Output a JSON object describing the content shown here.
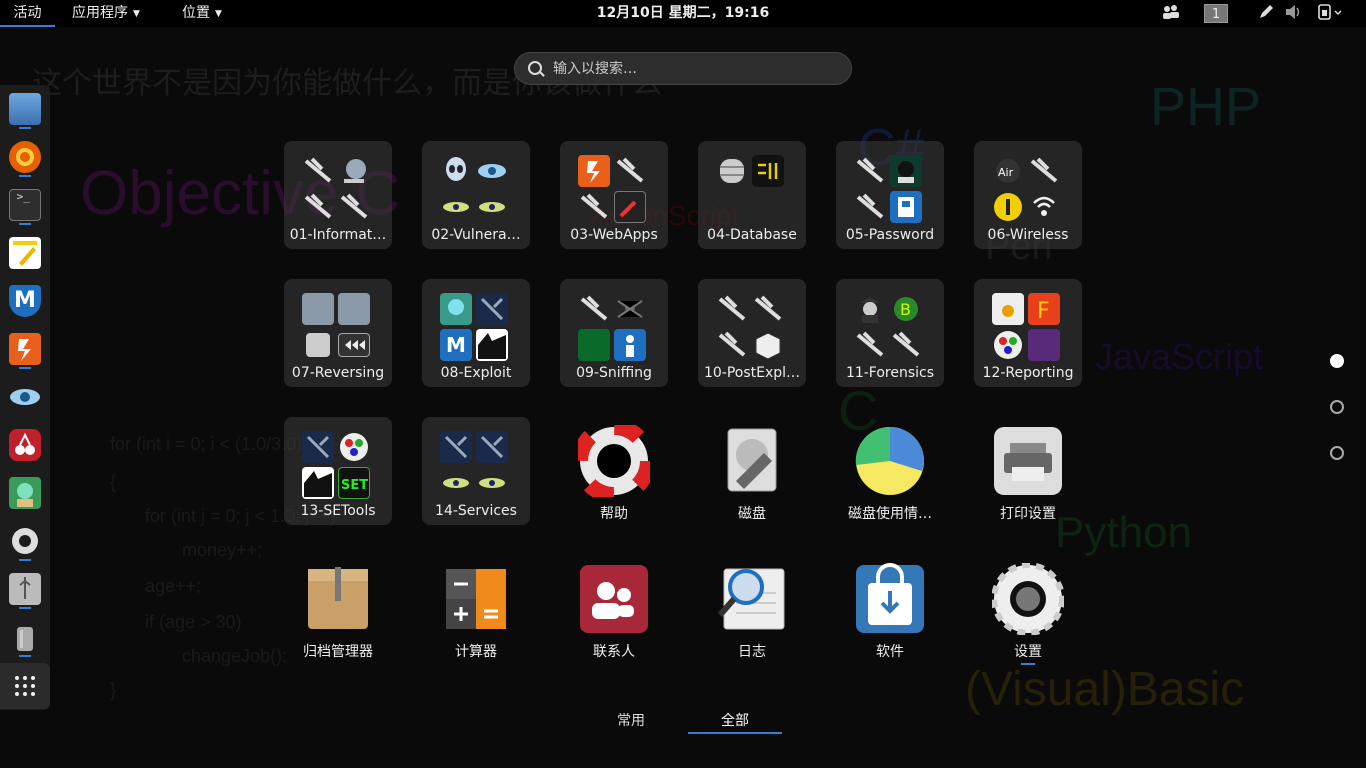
{
  "topbar": {
    "activities": "活动",
    "applications": "应用程序",
    "places": "位置",
    "clock": "12月10日 星期二，19:16",
    "workspace": "1",
    "tray_icons": [
      "people-icon",
      "pen-icon",
      "volume-icon",
      "power-icon"
    ]
  },
  "search": {
    "placeholder": "输入以搜索…"
  },
  "dash": {
    "items": [
      {
        "name": "files",
        "color": "#4a86c8"
      },
      {
        "name": "firefox",
        "color": "#e66000"
      },
      {
        "name": "terminal",
        "color": "#2e2e2e"
      },
      {
        "name": "text-editor",
        "color": "#f5d000"
      },
      {
        "name": "metasploit",
        "color": "#1e6fc0"
      },
      {
        "name": "burpsuite",
        "color": "#e8601c"
      },
      {
        "name": "zenmap",
        "color": "#6aaee0"
      },
      {
        "name": "cherrytree",
        "color": "#c0202a"
      },
      {
        "name": "armitage",
        "color": "#3a9a5a"
      },
      {
        "name": "settings",
        "color": "#dddddd"
      },
      {
        "name": "usb-installer",
        "color": "#cccccc"
      },
      {
        "name": "trash",
        "color": "#aaaaaa"
      }
    ]
  },
  "app_grid": {
    "folders": [
      {
        "label": "01-Informat…"
      },
      {
        "label": "02-Vulnera…"
      },
      {
        "label": "03-WebApps"
      },
      {
        "label": "04-Database"
      },
      {
        "label": "05-Password"
      },
      {
        "label": "06-Wireless"
      },
      {
        "label": "07-Reversing"
      },
      {
        "label": "08-Exploit"
      },
      {
        "label": "09-Sniffing"
      },
      {
        "label": "10-PostExpl…"
      },
      {
        "label": "11-Forensics"
      },
      {
        "label": "12-Reporting"
      },
      {
        "label": "13-SETools"
      },
      {
        "label": "14-Services"
      }
    ],
    "apps": [
      {
        "label": "帮助",
        "icon": "help-lifebuoy-icon"
      },
      {
        "label": "磁盘",
        "icon": "disk-wrench-icon"
      },
      {
        "label": "磁盘使用情…",
        "icon": "pie-chart-icon"
      },
      {
        "label": "打印设置",
        "icon": "printer-icon"
      },
      {
        "label": "归档管理器",
        "icon": "archive-box-icon"
      },
      {
        "label": "计算器",
        "icon": "calculator-icon"
      },
      {
        "label": "联系人",
        "icon": "contacts-icon"
      },
      {
        "label": "日志",
        "icon": "log-magnifier-icon"
      },
      {
        "label": "软件",
        "icon": "software-bag-icon"
      },
      {
        "label": "设置",
        "icon": "settings-gear-icon"
      }
    ]
  },
  "pages": {
    "current": 1,
    "total": 3
  },
  "view_tabs": {
    "frequent": "常用",
    "all": "全部",
    "active": "all"
  },
  "wallpaper": {
    "lines": [
      "这个世界不是因为你能做什么，而是你该做什么",
      "Objective C",
      "PHP",
      "C#",
      "ActionScript",
      "Perl",
      "JavaScript",
      "C",
      "Python",
      "(Visual)Basic",
      "for (int i = 0; i < (1.0/3.0); i++)",
      "{",
      "for (int j = 0; j < 1.0; j++)",
      "money++;",
      "age++;",
      "if (age > 30)",
      "changeJob();",
      "}"
    ]
  },
  "colors": {
    "accent": "#3a7bd5",
    "bar": "#000000",
    "folder_bg": "#3c3c3c"
  }
}
